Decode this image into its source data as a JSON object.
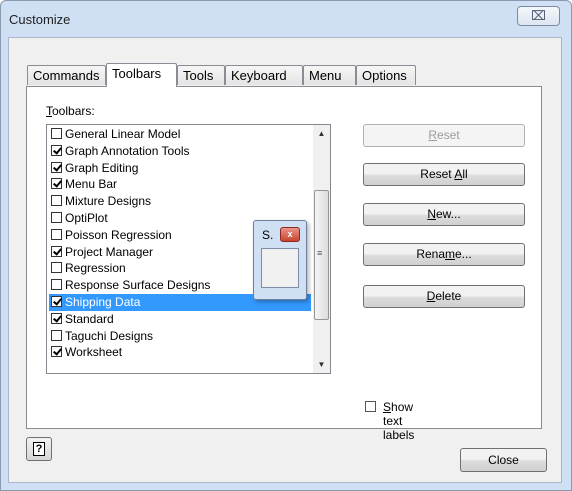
{
  "window": {
    "title": "Customize",
    "close_glyph": "⌧"
  },
  "tabs": [
    {
      "label": "Commands"
    },
    {
      "label": "Toolbars"
    },
    {
      "label": "Tools"
    },
    {
      "label": "Keyboard"
    },
    {
      "label": "Menu"
    },
    {
      "label": "Options"
    }
  ],
  "active_tab": "Toolbars",
  "toolbars": {
    "label_key": "T",
    "label_rest": "oolbars:",
    "items": [
      {
        "label": "General Linear Model",
        "checked": false
      },
      {
        "label": "Graph Annotation Tools",
        "checked": true
      },
      {
        "label": "Graph Editing",
        "checked": true
      },
      {
        "label": "Menu Bar",
        "checked": true
      },
      {
        "label": "Mixture Designs",
        "checked": false
      },
      {
        "label": "OptiPlot",
        "checked": false
      },
      {
        "label": "Poisson Regression",
        "checked": false
      },
      {
        "label": "Project Manager",
        "checked": true
      },
      {
        "label": "Regression",
        "checked": false
      },
      {
        "label": "Response Surface Designs",
        "checked": false
      },
      {
        "label": "Shipping Data",
        "checked": true,
        "selected": true
      },
      {
        "label": "Standard",
        "checked": true
      },
      {
        "label": "Taguchi Designs",
        "checked": false
      },
      {
        "label": "Worksheet",
        "checked": true
      }
    ]
  },
  "buttons": {
    "reset": {
      "key": "R",
      "rest": "eset",
      "enabled": false
    },
    "reset_all": {
      "pre": "Reset ",
      "key": "A",
      "rest": "ll"
    },
    "new": {
      "key": "N",
      "rest": "ew..."
    },
    "rename": {
      "pre": "Rena",
      "key": "m",
      "rest": "e..."
    },
    "delete": {
      "key": "D",
      "rest": "elete"
    },
    "close": "Close"
  },
  "show_text_labels": {
    "key": "S",
    "rest": "how text labels",
    "checked": false
  },
  "floating_toolbar": {
    "title": "S.",
    "close_glyph": "x"
  },
  "help_glyph": "?"
}
